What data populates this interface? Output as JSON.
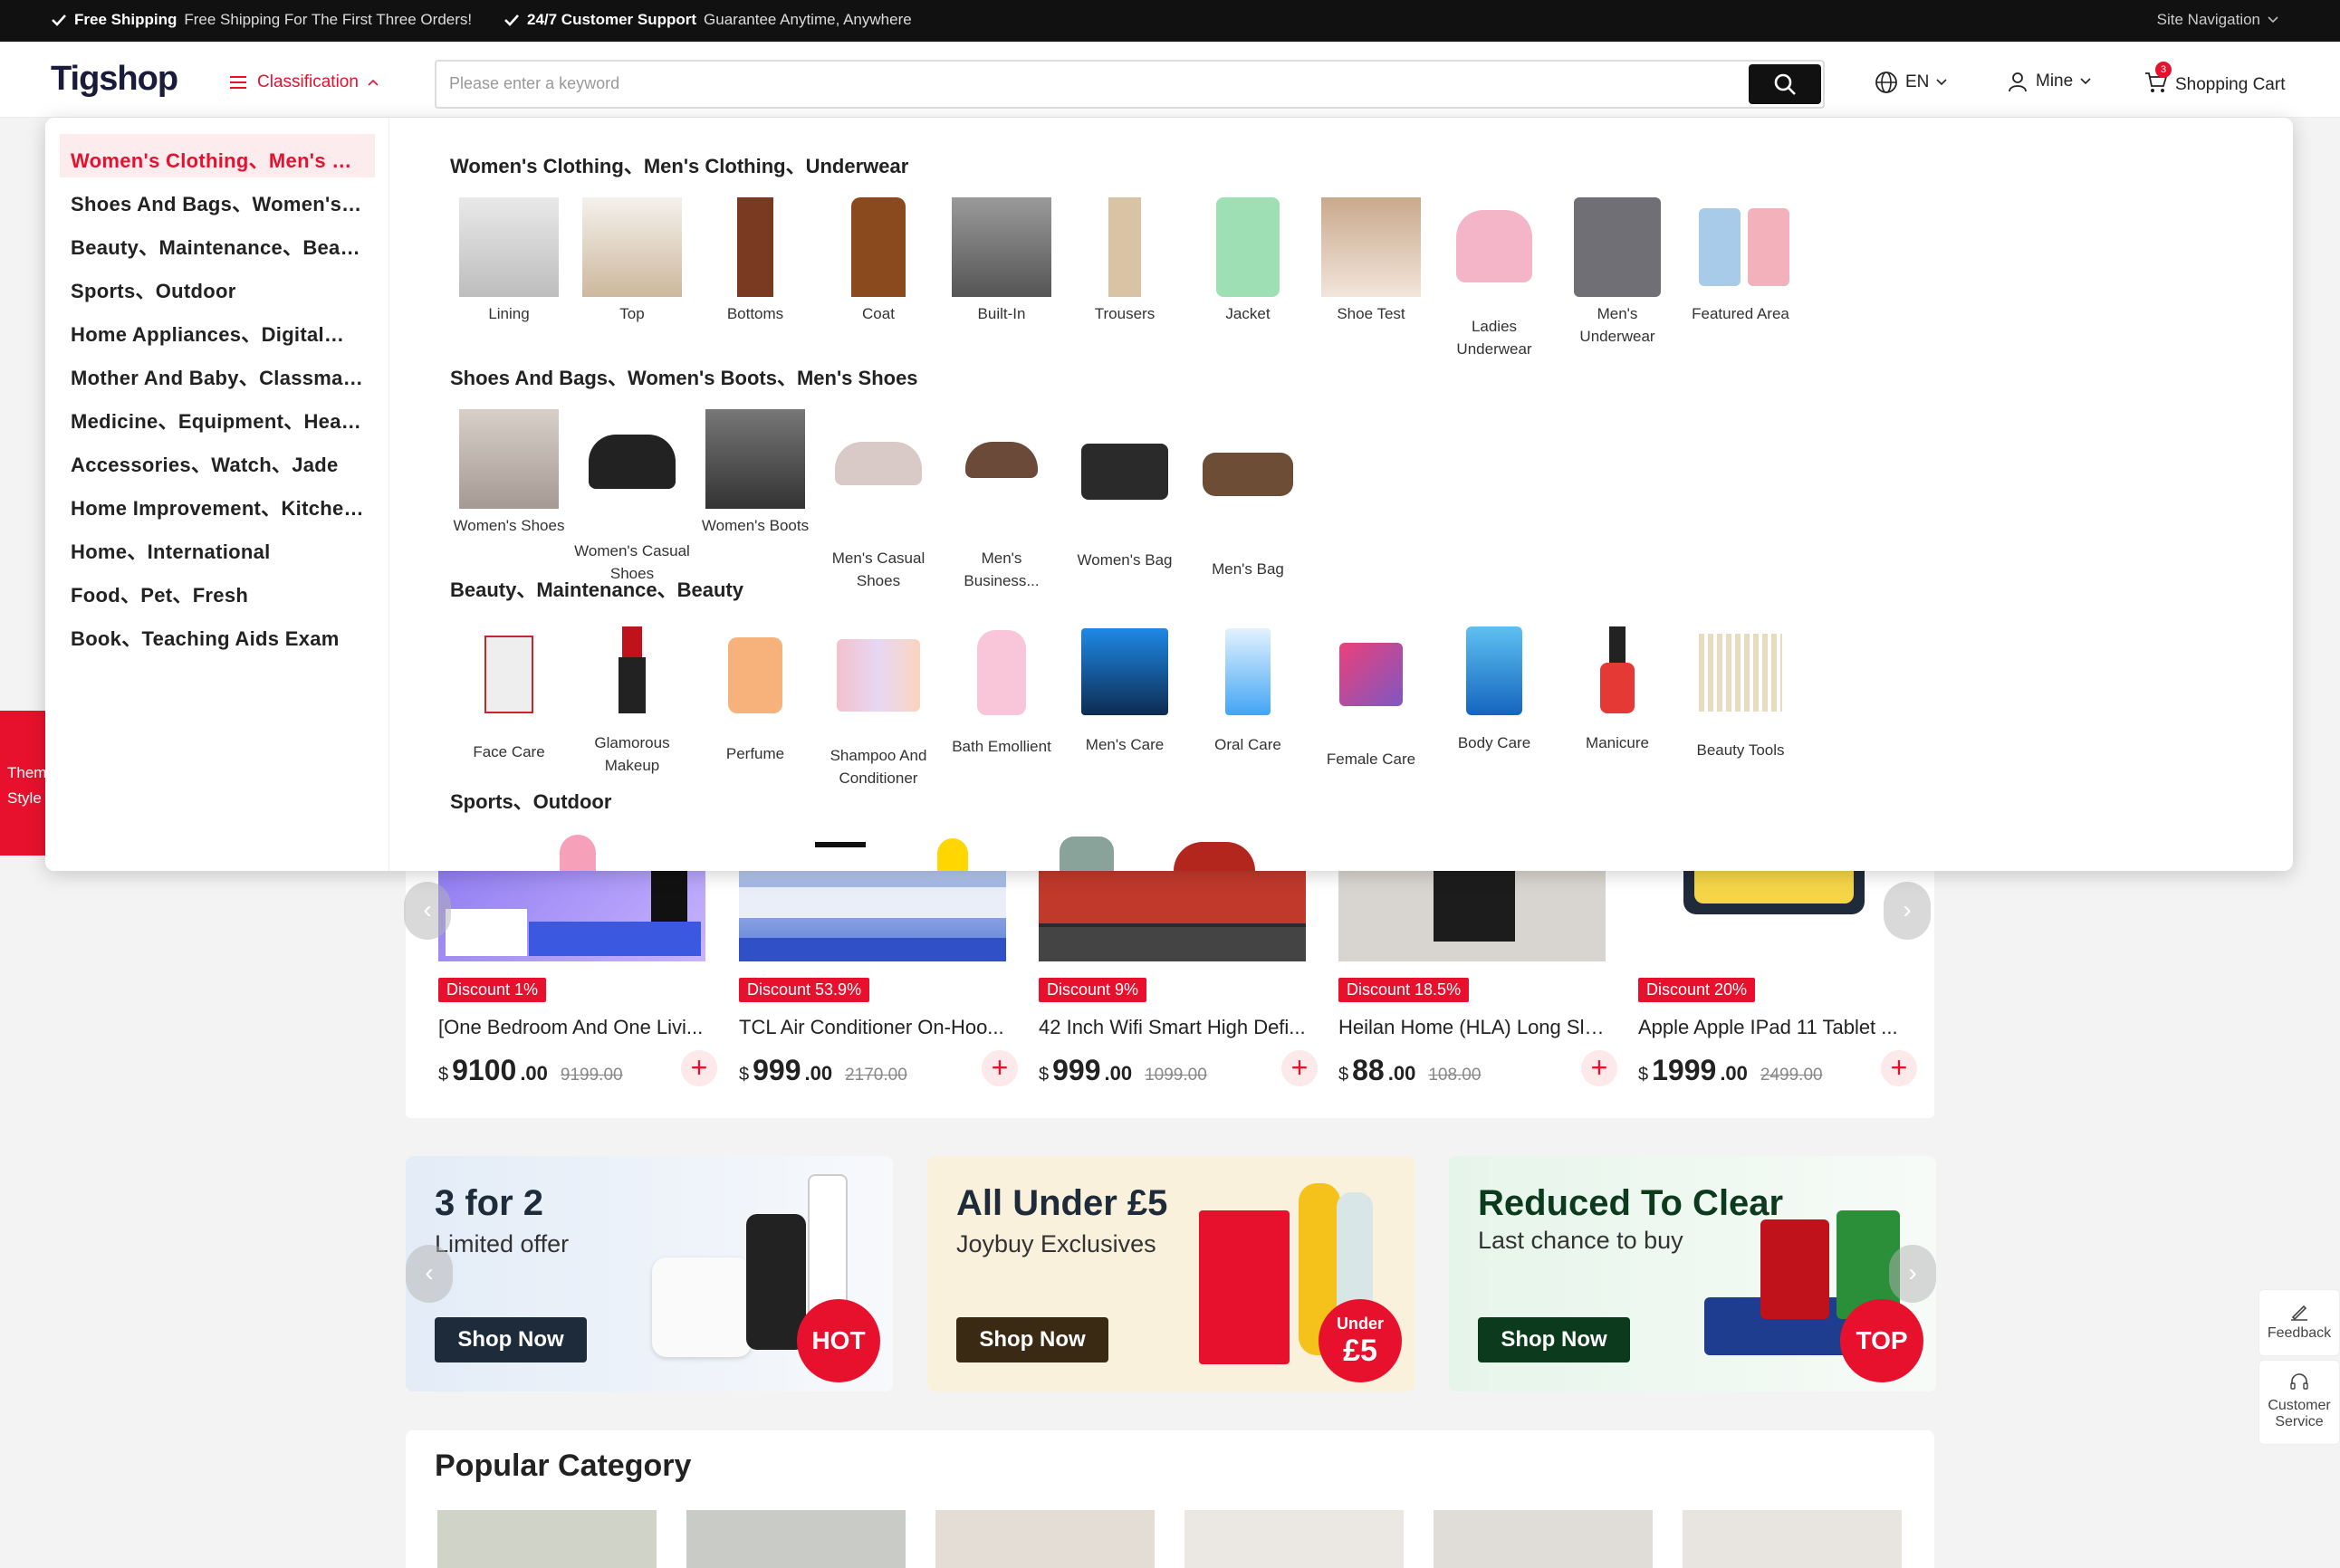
{
  "topbar": {
    "notice1_bold": "Free Shipping",
    "notice1_text": "Free Shipping For The First Three Orders!",
    "notice2_bold": "24/7 Customer Support",
    "notice2_text": "Guarantee Anytime, Anywhere",
    "site_nav": "Site Navigation"
  },
  "header": {
    "logo": "Tigshop",
    "classification": "Classification",
    "search_placeholder": "Please enter a keyword",
    "language": "EN",
    "mine": "Mine",
    "cart": "Shopping Cart",
    "cart_count": "3"
  },
  "theme_tab": {
    "line1": "Them",
    "line2": "Style"
  },
  "menu": {
    "categories": [
      "Women's Clothing、Men's Cl...",
      "Shoes And Bags、Women's B...",
      "Beauty、Maintenance、Beauty",
      "Sports、Outdoor",
      "Home Appliances、Digital、K...",
      "Mother And Baby、Classmat...",
      "Medicine、Equipment、Healt...",
      "Accessories、Watch、Jade",
      "Home Improvement、Kitchen...",
      "Home、International",
      "Food、Pet、Fresh",
      "Book、Teaching Aids Exam"
    ],
    "sections": [
      {
        "title": "Women's Clothing、Men's Clothing、Underwear",
        "items": [
          "Lining",
          "Top",
          "Bottoms",
          "Coat",
          "Built-In",
          "Trousers",
          "Jacket",
          "Shoe Test",
          "Ladies Underwear",
          "Men's Underwear",
          "Featured Area"
        ]
      },
      {
        "title": "Shoes And Bags、Women's Boots、Men's Shoes",
        "items": [
          "Women's Shoes",
          "Women's Casual Shoes",
          "Women's Boots",
          "Men's Casual Shoes",
          "Men's Business...",
          "Women's Bag",
          "Men's Bag"
        ]
      },
      {
        "title": "Beauty、Maintenance、Beauty",
        "items": [
          "Face Care",
          "Glamorous Makeup",
          "Perfume",
          "Shampoo And Conditioner",
          "Bath Emollient",
          "Men's Care",
          "Oral Care",
          "Female Care",
          "Body Care",
          "Manicure",
          "Beauty Tools"
        ]
      },
      {
        "title": "Sports、Outdoor",
        "items": []
      }
    ]
  },
  "products": [
    {
      "discount": "Discount 1%",
      "title": "[One Bedroom And One Livi...",
      "currency": "$",
      "price_int": "9100",
      "price_dec": ".00",
      "old": "9199.00"
    },
    {
      "discount": "Discount 53.9%",
      "title": "TCL Air Conditioner On-Hoo...",
      "currency": "$",
      "price_int": "999",
      "price_dec": ".00",
      "old": "2170.00"
    },
    {
      "discount": "Discount 9%",
      "title": "42 Inch Wifi Smart High Defi...",
      "currency": "$",
      "price_int": "999",
      "price_dec": ".00",
      "old": "1099.00"
    },
    {
      "discount": "Discount 18.5%",
      "title": "Heilan Home (HLA) Long Sle...",
      "currency": "$",
      "price_int": "88",
      "price_dec": ".00",
      "old": "108.00"
    },
    {
      "discount": "Discount 20%",
      "title": "Apple Apple IPad 11 Tablet ...",
      "currency": "$",
      "price_int": "1999",
      "price_dec": ".00",
      "old": "2499.00"
    }
  ],
  "banners": [
    {
      "title": "3 for 2",
      "subtitle": "Limited offer",
      "button": "Shop Now",
      "badge": "HOT",
      "color": "#1d2b3a"
    },
    {
      "title": "All Under £5",
      "subtitle": "Joybuy Exclusives",
      "button": "Shop Now",
      "badge_top": "Under",
      "badge": "£5",
      "color": "#3a2a14"
    },
    {
      "title": "Reduced To Clear",
      "subtitle": "Last chance to buy",
      "button": "Shop Now",
      "badge": "TOP",
      "color": "#0c3a1c"
    }
  ],
  "popular": {
    "title": "Popular Category"
  },
  "tools": {
    "feedback": "Feedback",
    "service_line1": "Customer",
    "service_line2": "Service"
  },
  "colors": {
    "accent": "#e8112d",
    "topbar": "#111111"
  }
}
